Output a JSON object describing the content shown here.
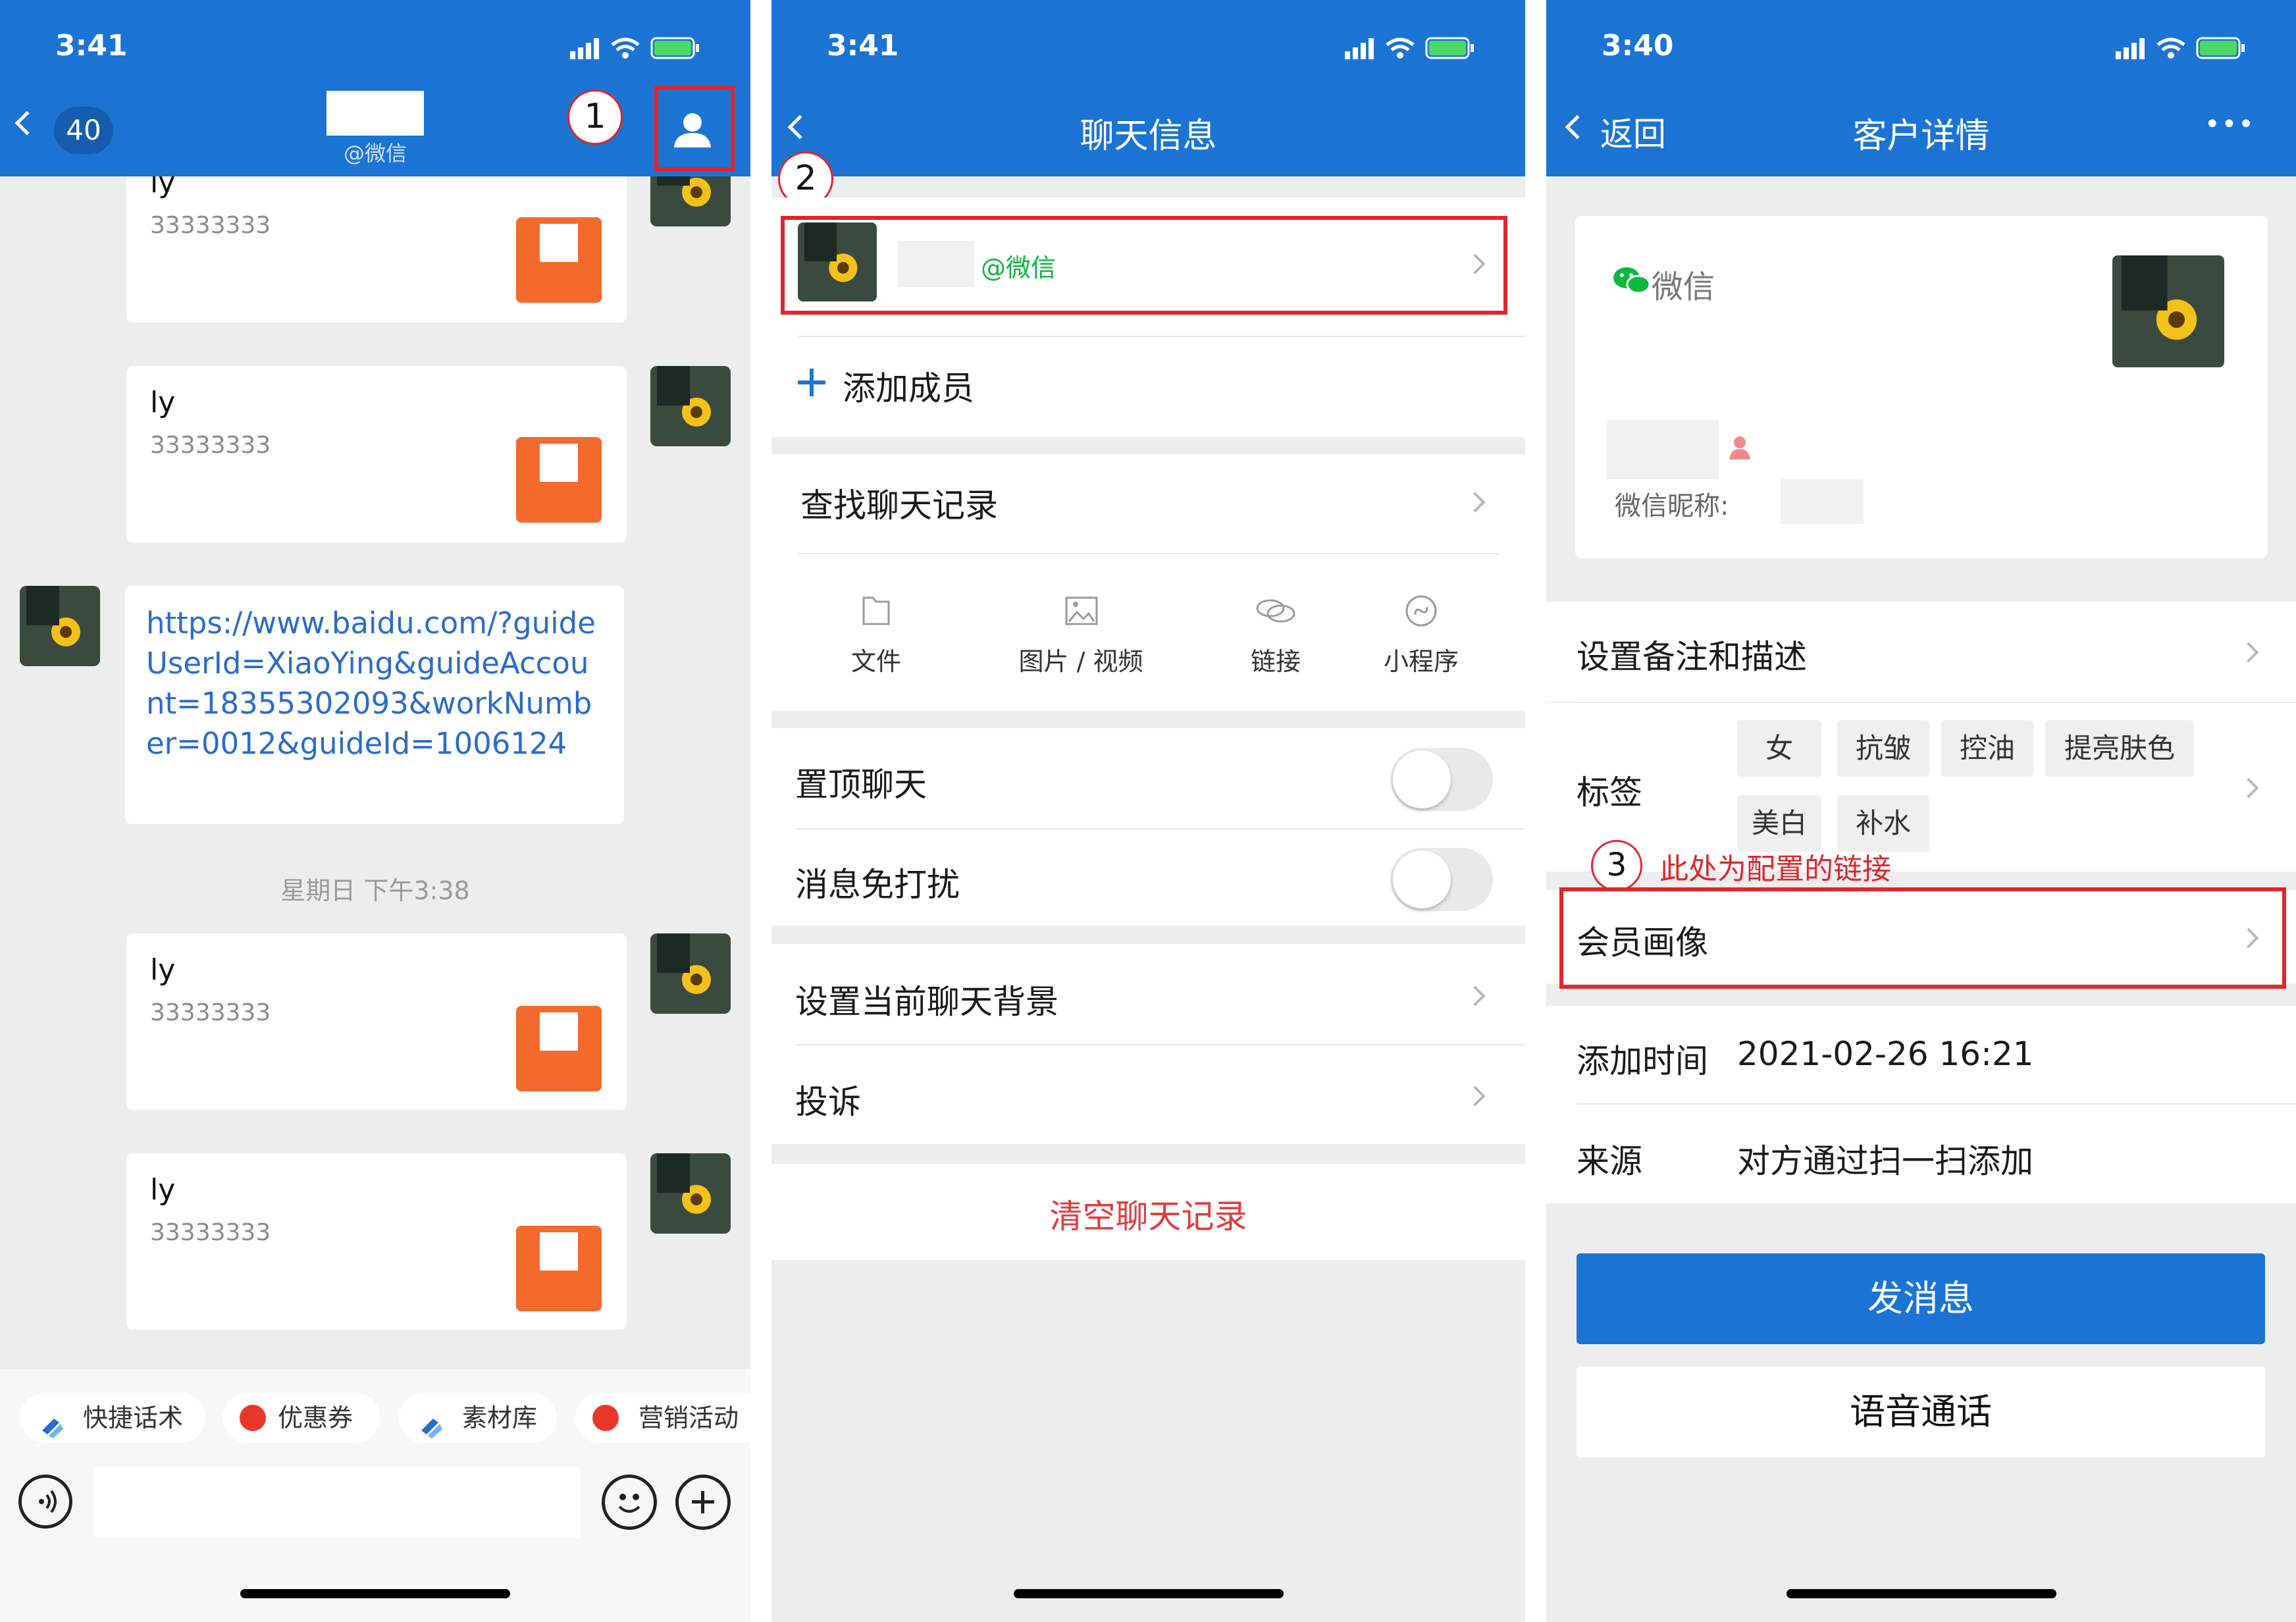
{
  "screen1": {
    "status_time": "3:41",
    "back_count": "40",
    "header_subtitle": "@微信",
    "messages": [
      {
        "name": "ly",
        "text": "33333333"
      },
      {
        "name": "ly",
        "text": "33333333"
      },
      {
        "link": "https://www.baidu.com/?guideUserId=XiaoYing&guideAccount=18355302093&workNumber=0012&guideId=1006124"
      },
      {
        "name": "ly",
        "text": "33333333"
      },
      {
        "name": "ly",
        "text": "33333333"
      }
    ],
    "timestamp": "星期日 下午3:38",
    "quick_chips": [
      "快捷话术",
      "优惠券",
      "素材库",
      "营销活动"
    ],
    "annotation": "1"
  },
  "screen2": {
    "status_time": "3:41",
    "title": "聊天信息",
    "member_suffix": "@微信",
    "add_member": "添加成员",
    "search_history": "查找聊天记录",
    "categories": [
      {
        "icon": "folder-icon",
        "label": "文件"
      },
      {
        "icon": "image-icon",
        "label": "图片 / 视频"
      },
      {
        "icon": "link-icon",
        "label": "链接"
      },
      {
        "icon": "mini-program-icon",
        "label": "小程序"
      }
    ],
    "pin_chat": "置顶聊天",
    "mute": "消息免打扰",
    "chat_background": "设置当前聊天背景",
    "report": "投诉",
    "clear_history": "清空聊天记录",
    "annotation": "2"
  },
  "screen3": {
    "status_time": "3:40",
    "back_label": "返回",
    "title": "客户详情",
    "more": "•••",
    "wechat_label": "微信",
    "nickname_label": "微信昵称:",
    "set_remark": "设置备注和描述",
    "tags_label": "标签",
    "tags": [
      "女",
      "抗皱",
      "控油",
      "提亮肤色",
      "美白",
      "补水"
    ],
    "annotation_num": "3",
    "annotation_text": "此处为配置的链接",
    "member_profile": "会员画像",
    "add_time_label": "添加时间",
    "add_time_value": "2021-02-26 16:21",
    "source_label": "来源",
    "source_value": "对方通过扫一扫添加",
    "send_message": "发消息",
    "voice_call": "语音通话"
  },
  "colors": {
    "brand_blue": "#1b74d3",
    "annotation_red": "#e0252d",
    "wechat_green": "#09b83e",
    "link_blue": "#2a6cc9",
    "danger_red": "#e33b3b"
  }
}
